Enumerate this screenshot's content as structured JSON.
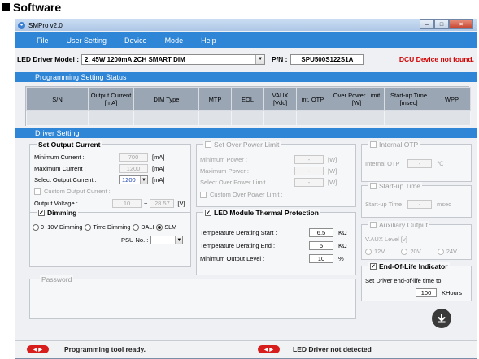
{
  "heading": {
    "text": "Software"
  },
  "window": {
    "title": "SMPro v2.0",
    "controls": {
      "minimize": "–",
      "maximize": "□",
      "close": "×"
    }
  },
  "menu": {
    "items": [
      "File",
      "User Setting",
      "Device",
      "Mode",
      "Help"
    ]
  },
  "model_row": {
    "label": "LED Driver Model :",
    "model_value": "2. 45W 1200mA 2CH SMART DIM",
    "pn_label": "P/N :",
    "pn_value": "SPU500S122S1A",
    "dcu_status": "DCU Device not found."
  },
  "programming_status": {
    "title": "Programming Setting Status",
    "columns": [
      "S/N",
      "Output Current\n[mA]",
      "DIM Type",
      "MTP",
      "EOL",
      "VAUX\n[Vdc]",
      "int. OTP",
      "Over Power Limit\n[W]",
      "Start-up Time\n[msec]",
      "WPP"
    ]
  },
  "driver_setting": {
    "title": "Driver Setting",
    "set_output_current": {
      "title": "Set Output Current",
      "min_label": "Minimum Current :",
      "min_value": "700",
      "min_unit": "[mA]",
      "max_label": "Maximum Current :",
      "max_value": "1200",
      "max_unit": "[mA]",
      "select_label": "Select Output Current :",
      "select_value": "1200",
      "select_unit": "[mA]",
      "custom_label": "Custom Output Current :",
      "voltage_label": "Output Voltage :",
      "voltage_min": "10",
      "tilde": "~",
      "voltage_max": "28.57",
      "voltage_unit": "[V]"
    },
    "dimming": {
      "title": "Dimming",
      "options": [
        "0~10V Dimming",
        "Time Dimming",
        "DALI",
        "SLM"
      ],
      "selected": "SLM",
      "psu_label": "PSU No. :"
    },
    "password": {
      "title": "Password"
    },
    "over_power": {
      "title": "Set Over Power Limit",
      "min_label": "Minimum Power :",
      "min_value": "-",
      "min_unit": "[W]",
      "max_label": "Maximum Power :",
      "max_value": "-",
      "max_unit": "[W]",
      "select_label": "Select Over Power Limit :",
      "select_value": "-",
      "select_unit": "[W]",
      "custom_label": "Custom Over Power Limit :"
    },
    "thermal": {
      "title": "LED Module Thermal Protection",
      "start_label": "Temperature Derating Start :",
      "start_value": "6.5",
      "start_unit": "KΩ",
      "end_label": "Temperature Derating End :",
      "end_value": "5",
      "end_unit": "KΩ",
      "min_label": "Minimum Output Level :",
      "min_value": "10",
      "min_unit": "%"
    },
    "internal_otp": {
      "title": "Internal OTP",
      "label": "Internal OTP",
      "value": "-",
      "unit": "℃"
    },
    "startup": {
      "title": "Start-up Time",
      "label": "Start-up Time",
      "value": "-",
      "unit": "msec"
    },
    "aux": {
      "title": "Auxiliary Output",
      "label": "V.AUX Level  [v]",
      "options": [
        "12V",
        "20V",
        "24V"
      ]
    },
    "eol": {
      "title": "End-Of-Life Indicator",
      "label": "Set Driver end-of-life time to",
      "value": "100",
      "unit": "KHours"
    }
  },
  "status": {
    "left_badge": "◀ ▶",
    "left_text": "Programming tool ready.",
    "right_badge": "◀ ▶",
    "right_text": "LED Driver not detected"
  },
  "colors": {
    "accent": "#2f86d6",
    "error": "#d40000",
    "badge": "#d81d1d"
  }
}
